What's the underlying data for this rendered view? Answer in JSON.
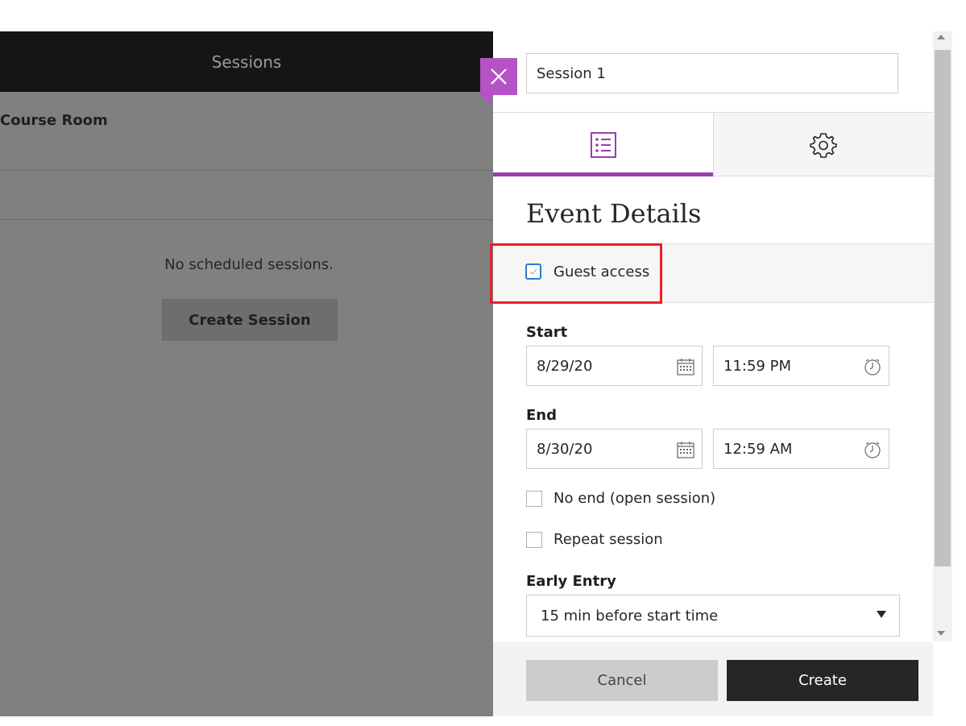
{
  "left_panel": {
    "header_title": "Sessions",
    "room_title": "Course Room",
    "empty_message": "No scheduled sessions.",
    "create_session_label": "Create Session"
  },
  "session_form": {
    "close_icon": "close-icon",
    "title_value": "Session 1",
    "tabs": [
      {
        "icon": "list-icon",
        "selected": true
      },
      {
        "icon": "gear-icon",
        "selected": false
      }
    ],
    "section_title": "Event Details",
    "guest_access": {
      "label": "Guest access",
      "checked": true
    },
    "start": {
      "label": "Start",
      "date": "8/29/20",
      "time": "11:59 PM"
    },
    "end": {
      "label": "End",
      "date": "8/30/20",
      "time": "12:59 AM"
    },
    "no_end": {
      "label": "No end (open session)",
      "checked": false
    },
    "repeat": {
      "label": "Repeat session",
      "checked": false
    },
    "early_entry": {
      "label": "Early Entry",
      "selected": "15 min before start time"
    },
    "cancel_label": "Cancel",
    "create_label": "Create"
  },
  "colors": {
    "accent": "#9a3db0",
    "close_button": "#b553c6",
    "highlight": "#e8202a",
    "primary_button": "#262626"
  }
}
